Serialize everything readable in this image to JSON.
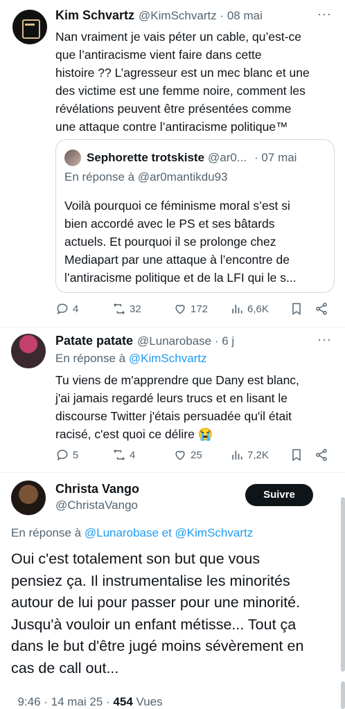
{
  "tweet1": {
    "display_name": "Kim Schvartz",
    "handle_time": "@KimSchvartz · 08 mai",
    "text_lines": [
      "Nan vraiment je vais péter un cable, qu’est-ce",
      "que l’antiracisme vient faire dans cette",
      "histoire ?? L’agresseur est un mec blanc et une",
      "des victime est une femme noire, comment les",
      "révélations peuvent être présentées comme",
      "une attaque contre l’antiracisme politique™"
    ],
    "quote": {
      "display_name": "Sephorette trotskiste",
      "handle": "@ar0...",
      "time": "· 07 mai",
      "reply_to": "En réponse à @ar0mantikdu93",
      "text_lines": [
        "Voilà pourquoi ce féminisme moral s’est si",
        "bien accordé avec le PS et ses bâtards",
        "actuels. Et pourquoi il se prolonge chez",
        "Mediapart par une attaque à l’encontre de",
        "l’antiracisme politique et de la LFI qui le s..."
      ]
    },
    "actions": {
      "replies": "4",
      "retweets": "32",
      "likes": "172",
      "views": "6,6K"
    }
  },
  "tweet2": {
    "display_name": "Patate patate",
    "handle_time": "@Lunarobase · 6 j",
    "reply_prefix": "En réponse à",
    "reply_handle": "@KimSchvartz",
    "text_lines": [
      "Tu viens de m'apprendre que Dany est blanc,",
      "j'ai jamais regardé leurs trucs et en lisant le",
      "discourse Twitter j'étais persuadée qu'il était",
      "racisé, c'est quoi ce délire 😭"
    ],
    "actions": {
      "replies": "5",
      "retweets": "4",
      "likes": "25",
      "views": "7,2K"
    }
  },
  "tweet3": {
    "display_name": "Christa Vango",
    "handle": "@ChristaVango",
    "follow_label": "Suivre",
    "reply_prefix": "En réponse à",
    "reply_handles": "@Lunarobase et @KimSchvartz",
    "text_lines": [
      "Oui c'est totalement son but que vous",
      "pensiez ça. Il instrumentalise les minorités",
      "autour de lui pour passer pour une minorité.",
      "Jusqu'à vouloir un enfant métisse... Tout ça",
      "dans le but d'être jugé moins sévèrement en",
      "cas de call out..."
    ],
    "meta_time": "9:46 · 14 mai 25 · ",
    "views_count": "454",
    "views_label": " Vues"
  },
  "icons": {
    "reply": "reply-icon",
    "retweet": "retweet-icon",
    "like": "heart-icon",
    "views": "views-icon",
    "bookmark": "bookmark-icon",
    "share": "share-icon"
  },
  "colors": {
    "accent": "#1d9bf0",
    "text": "#0f1419",
    "secondary": "#536471",
    "border": "#cfd9de"
  }
}
